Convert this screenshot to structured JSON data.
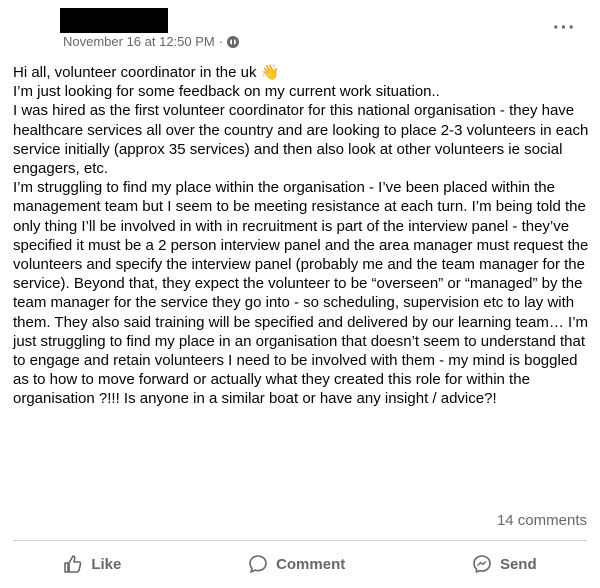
{
  "post": {
    "timestamp": "November 16 at 12:50 PM",
    "separator": "·",
    "privacy_icon": "globe-icon",
    "more_icon": "more-options-icon",
    "lines": [
      "Hi all, volunteer coordinator in the uk",
      "I’m just looking for some feedback on my current work situation..",
      "I was hired as the first volunteer coordinator for this national organisation - they have healthcare services all over the country and are looking to place 2-3 volunteers in each service initially (approx 35 services) and then also look at other volunteers ie social engagers, etc.",
      "I’m struggling to find my place within the organisation - I’ve been placed within the management team but I seem to be meeting resistance at each turn.  I’m being told the only thing I’ll be involved in with in recruitment is part of the interview panel - they’ve specified it must be a 2 person interview panel and the area manager must request the volunteers and specify the interview panel (probably me and the team manager for the service).  Beyond that, they expect the volunteer to be “overseen” or “managed” by the team manager for the service they go into - so scheduling, supervision etc to lay with them.  They also said training will be specified and delivered by our learning team… I’m just struggling to find my place in an organisation that doesn’t seem to understand that to engage and retain volunteers I need to be involved with them - my mind is boggled as to how to move forward or actually what they created this role for within the organisation ?!!!  Is anyone in a similar boat or have any insight / advice?!"
    ],
    "wave_emoji": "👋",
    "comments_count": "14 comments"
  },
  "actions": {
    "like": "Like",
    "comment": "Comment",
    "send": "Send"
  }
}
